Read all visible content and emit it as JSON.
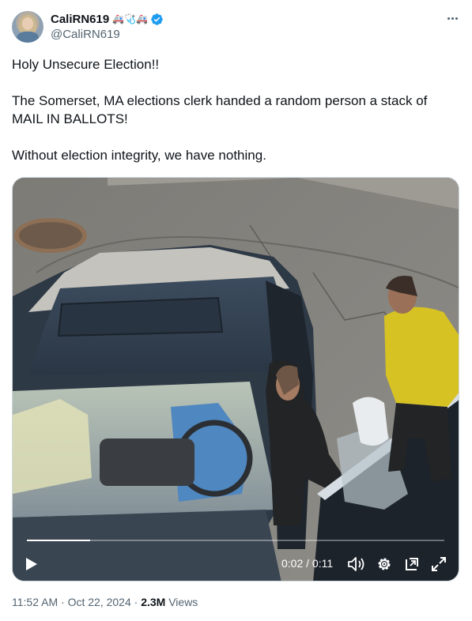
{
  "author": {
    "display_name": "CaliRN619",
    "emoji": "🚑🩺🚑",
    "handle": "@CaliRN619"
  },
  "tweet": {
    "paragraphs": [
      "Holy Unsecure Election!!",
      "The Somerset, MA elections clerk handed a random person a stack of MAIL IN BALLOTS!",
      "Without election integrity, we have nothing."
    ]
  },
  "video": {
    "time_display": "0:02 / 0:11",
    "progress": 0.15
  },
  "meta": {
    "time": "11:52 AM",
    "date": "Oct 22, 2024",
    "views_count": "2.3M",
    "views_label": "Views",
    "separator": "·"
  },
  "colors": {
    "verified": "#1d9bf0",
    "text_primary": "#0f1419",
    "text_secondary": "#536471"
  }
}
